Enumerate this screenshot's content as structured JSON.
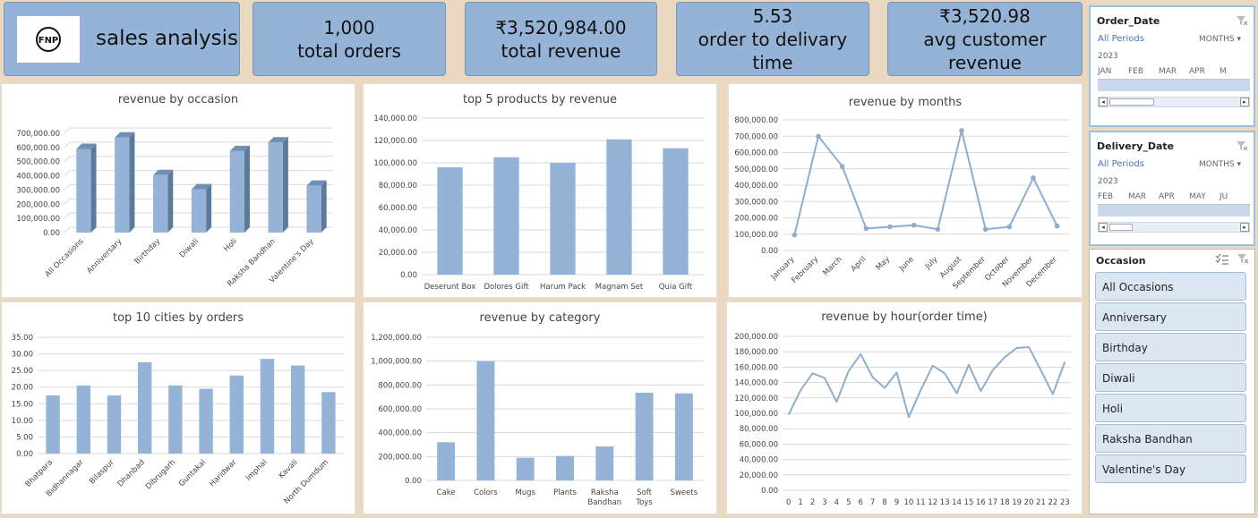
{
  "header": {
    "logo_text": "FNP",
    "title": "sales analysis",
    "kpis": [
      {
        "value": "1,000",
        "label": "total orders"
      },
      {
        "value": "₹3,520,984.00",
        "label": "total revenue"
      },
      {
        "value": "5.53",
        "label": "order to delivary time"
      },
      {
        "value": "₹3,520.98",
        "label": "avg customer revenue"
      }
    ]
  },
  "colors": {
    "bar": "#95b3d7",
    "bar_dark": "#5c7a9a",
    "line": "#8eaed0",
    "grid": "#d9d9d9",
    "kpi_bg": "#95b3d7",
    "page_bg": "#ead9c0"
  },
  "chart_data": [
    {
      "type": "bar",
      "style": "3d",
      "title": "revenue by occasion",
      "categories": [
        "All Occasions",
        "Anniversary",
        "Birthday",
        "Diwali",
        "Holi",
        "Raksha Bandhan",
        "Valentine's Day"
      ],
      "values": [
        590000,
        670000,
        405000,
        305000,
        575000,
        635000,
        330000
      ],
      "ylim": [
        0,
        700000
      ],
      "ystep": 100000,
      "ticks": [
        "0.00",
        "100,000.00",
        "200,000.00",
        "300,000.00",
        "400,000.00",
        "500,000.00",
        "600,000.00",
        "700,000.00"
      ],
      "grid": true
    },
    {
      "type": "bar",
      "title": "top 5 products by revenue",
      "categories": [
        "Deserunt Box",
        "Dolores Gift",
        "Harum Pack",
        "Magnam Set",
        "Quia Gift"
      ],
      "values": [
        96000,
        105000,
        100000,
        121000,
        113000
      ],
      "ylim": [
        0,
        140000
      ],
      "ystep": 20000,
      "ticks": [
        "0.00",
        "20,000.00",
        "40,000.00",
        "60,000.00",
        "80,000.00",
        "100,000.00",
        "120,000.00",
        "140,000.00"
      ],
      "grid": true
    },
    {
      "type": "line",
      "title": "revenue by months",
      "categories": [
        "January",
        "February",
        "March",
        "April",
        "May",
        "June",
        "July",
        "August",
        "September",
        "October",
        "November",
        "December"
      ],
      "values": [
        95000,
        700000,
        515000,
        135000,
        145000,
        155000,
        130000,
        735000,
        130000,
        145000,
        445000,
        150000
      ],
      "ylim": [
        0,
        800000
      ],
      "ystep": 100000,
      "ticks": [
        "0.00",
        "100,000.00",
        "200,000.00",
        "300,000.00",
        "400,000.00",
        "500,000.00",
        "600,000.00",
        "700,000.00",
        "800,000.00"
      ],
      "grid": true,
      "markers": true
    },
    {
      "type": "bar",
      "title": "top 10 cities by orders",
      "categories": [
        "Bhatpara",
        "Bidhannagar",
        "Bilaspur",
        "Dhanbad",
        "Dibrugarh",
        "Guntakal",
        "Haridwar",
        "Imphal",
        "Kavali",
        "North Dumdum"
      ],
      "values": [
        17.5,
        20.5,
        17.5,
        27.5,
        20.5,
        19.5,
        23.5,
        28.5,
        26.5,
        18.5
      ],
      "ylim": [
        0,
        35
      ],
      "ystep": 5,
      "ticks": [
        "0.00",
        "5.00",
        "10.00",
        "15.00",
        "20.00",
        "25.00",
        "30.00",
        "35.00"
      ],
      "grid": true
    },
    {
      "type": "bar",
      "title": "revenue by category",
      "categories": [
        "Cake",
        "Colors",
        "Mugs",
        "Plants",
        "Raksha Bandhan",
        "Soft Toys",
        "Sweets"
      ],
      "values": [
        320000,
        1000000,
        190000,
        205000,
        285000,
        735000,
        730000
      ],
      "ylim": [
        0,
        1200000
      ],
      "ystep": 200000,
      "ticks": [
        "0.00",
        "200,000.00",
        "400,000.00",
        "600,000.00",
        "800,000.00",
        "1,000,000.00",
        "1,200,000.00"
      ],
      "grid": true
    },
    {
      "type": "line",
      "title": "revenue by hour(order time)",
      "categories": [
        "0",
        "1",
        "2",
        "3",
        "4",
        "5",
        "6",
        "7",
        "8",
        "9",
        "10",
        "11",
        "12",
        "13",
        "14",
        "15",
        "16",
        "17",
        "18",
        "19",
        "20",
        "21",
        "22",
        "23"
      ],
      "values": [
        98000,
        130000,
        152000,
        146000,
        115000,
        155000,
        177000,
        147000,
        133000,
        153000,
        95000,
        130000,
        162000,
        152000,
        126000,
        163000,
        129000,
        156000,
        173000,
        185000,
        186000,
        156000,
        125000,
        167000
      ],
      "ylim": [
        0,
        200000
      ],
      "ystep": 20000,
      "ticks": [
        "0.00",
        "20,000.00",
        "40,000.00",
        "60,000.00",
        "80,000.00",
        "100,000.00",
        "120,000.00",
        "140,000.00",
        "160,000.00",
        "180,000.00",
        "200,000.00"
      ],
      "grid": true,
      "markers": false
    }
  ],
  "slicers": {
    "order_date": {
      "title": "Order_Date",
      "periods": "All Periods",
      "level": "MONTHS",
      "year": "2023",
      "months": [
        "JAN",
        "FEB",
        "MAR",
        "APR",
        "M"
      ]
    },
    "delivery_date": {
      "title": "Delivery_Date",
      "periods": "All Periods",
      "level": "MONTHS",
      "year": "2023",
      "months": [
        "FEB",
        "MAR",
        "APR",
        "MAY",
        "JU"
      ]
    },
    "occasion": {
      "title": "Occasion",
      "items": [
        "All Occasions",
        "Anniversary",
        "Birthday",
        "Diwali",
        "Holi",
        "Raksha Bandhan",
        "Valentine's Day"
      ]
    }
  }
}
